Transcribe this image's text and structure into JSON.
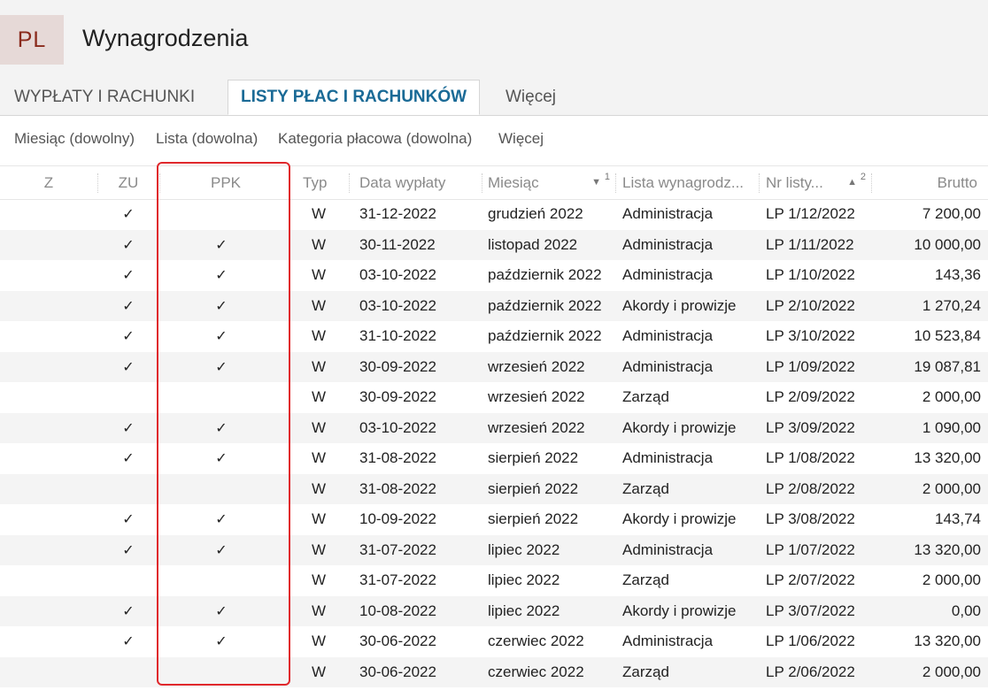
{
  "app": {
    "badge": "PL",
    "title": "Wynagrodzenia"
  },
  "tabs": [
    {
      "label": "WYPŁATY I RACHUNKI",
      "active": false
    },
    {
      "label": "LISTY PŁAC I RACHUNKÓW",
      "active": true
    },
    {
      "label": "Więcej",
      "active": false
    }
  ],
  "filters": [
    {
      "label": "Miesiąc (dowolny)"
    },
    {
      "label": "Lista (dowolna)"
    },
    {
      "label": "Kategoria płacowa (dowolna)"
    },
    {
      "label": "Więcej"
    }
  ],
  "columns": {
    "z": "Z",
    "zu": "ZU",
    "ppk": "PPK",
    "typ": "Typ",
    "data": "Data wypłaty",
    "miesiac": "Miesiąc",
    "miesiac_sort": "1",
    "lista": "Lista wynagrodz...",
    "nr": "Nr listy...",
    "nr_sort": "2",
    "brutto": "Brutto"
  },
  "check_glyph": "✓",
  "colors": {
    "accent": "#1a6a96",
    "badge_text": "#8a2a1c",
    "highlight": "#e0282c"
  },
  "rows": [
    {
      "z": "",
      "zu": "✓",
      "ppk": "",
      "typ": "W",
      "data": "31-12-2022",
      "miesiac": "grudzień 2022",
      "lista": "Administracja",
      "nr": "LP 1/12/2022",
      "brutto": "7 200,00"
    },
    {
      "z": "",
      "zu": "✓",
      "ppk": "✓",
      "typ": "W",
      "data": "30-11-2022",
      "miesiac": "listopad 2022",
      "lista": "Administracja",
      "nr": "LP 1/11/2022",
      "brutto": "10 000,00"
    },
    {
      "z": "",
      "zu": "✓",
      "ppk": "✓",
      "typ": "W",
      "data": "03-10-2022",
      "miesiac": "październik 2022",
      "lista": "Administracja",
      "nr": "LP 1/10/2022",
      "brutto": "143,36"
    },
    {
      "z": "",
      "zu": "✓",
      "ppk": "✓",
      "typ": "W",
      "data": "03-10-2022",
      "miesiac": "październik 2022",
      "lista": "Akordy i prowizje",
      "nr": "LP 2/10/2022",
      "brutto": "1 270,24"
    },
    {
      "z": "",
      "zu": "✓",
      "ppk": "✓",
      "typ": "W",
      "data": "31-10-2022",
      "miesiac": "październik 2022",
      "lista": "Administracja",
      "nr": "LP 3/10/2022",
      "brutto": "10 523,84"
    },
    {
      "z": "",
      "zu": "✓",
      "ppk": "✓",
      "typ": "W",
      "data": "30-09-2022",
      "miesiac": "wrzesień 2022",
      "lista": "Administracja",
      "nr": "LP 1/09/2022",
      "brutto": "19 087,81"
    },
    {
      "z": "",
      "zu": "",
      "ppk": "",
      "typ": "W",
      "data": "30-09-2022",
      "miesiac": "wrzesień 2022",
      "lista": "Zarząd",
      "nr": "LP 2/09/2022",
      "brutto": "2 000,00"
    },
    {
      "z": "",
      "zu": "✓",
      "ppk": "✓",
      "typ": "W",
      "data": "03-10-2022",
      "miesiac": "wrzesień 2022",
      "lista": "Akordy i prowizje",
      "nr": "LP 3/09/2022",
      "brutto": "1 090,00"
    },
    {
      "z": "",
      "zu": "✓",
      "ppk": "✓",
      "typ": "W",
      "data": "31-08-2022",
      "miesiac": "sierpień 2022",
      "lista": "Administracja",
      "nr": "LP 1/08/2022",
      "brutto": "13 320,00"
    },
    {
      "z": "",
      "zu": "",
      "ppk": "",
      "typ": "W",
      "data": "31-08-2022",
      "miesiac": "sierpień 2022",
      "lista": "Zarząd",
      "nr": "LP 2/08/2022",
      "brutto": "2 000,00"
    },
    {
      "z": "",
      "zu": "✓",
      "ppk": "✓",
      "typ": "W",
      "data": "10-09-2022",
      "miesiac": "sierpień 2022",
      "lista": "Akordy i prowizje",
      "nr": "LP 3/08/2022",
      "brutto": "143,74"
    },
    {
      "z": "",
      "zu": "✓",
      "ppk": "✓",
      "typ": "W",
      "data": "31-07-2022",
      "miesiac": "lipiec 2022",
      "lista": "Administracja",
      "nr": "LP 1/07/2022",
      "brutto": "13 320,00"
    },
    {
      "z": "",
      "zu": "",
      "ppk": "",
      "typ": "W",
      "data": "31-07-2022",
      "miesiac": "lipiec 2022",
      "lista": "Zarząd",
      "nr": "LP 2/07/2022",
      "brutto": "2 000,00"
    },
    {
      "z": "",
      "zu": "✓",
      "ppk": "✓",
      "typ": "W",
      "data": "10-08-2022",
      "miesiac": "lipiec 2022",
      "lista": "Akordy i prowizje",
      "nr": "LP 3/07/2022",
      "brutto": "0,00"
    },
    {
      "z": "",
      "zu": "✓",
      "ppk": "✓",
      "typ": "W",
      "data": "30-06-2022",
      "miesiac": "czerwiec 2022",
      "lista": "Administracja",
      "nr": "LP 1/06/2022",
      "brutto": "13 320,00"
    },
    {
      "z": "",
      "zu": "",
      "ppk": "",
      "typ": "W",
      "data": "30-06-2022",
      "miesiac": "czerwiec 2022",
      "lista": "Zarząd",
      "nr": "LP 2/06/2022",
      "brutto": "2 000,00"
    }
  ]
}
